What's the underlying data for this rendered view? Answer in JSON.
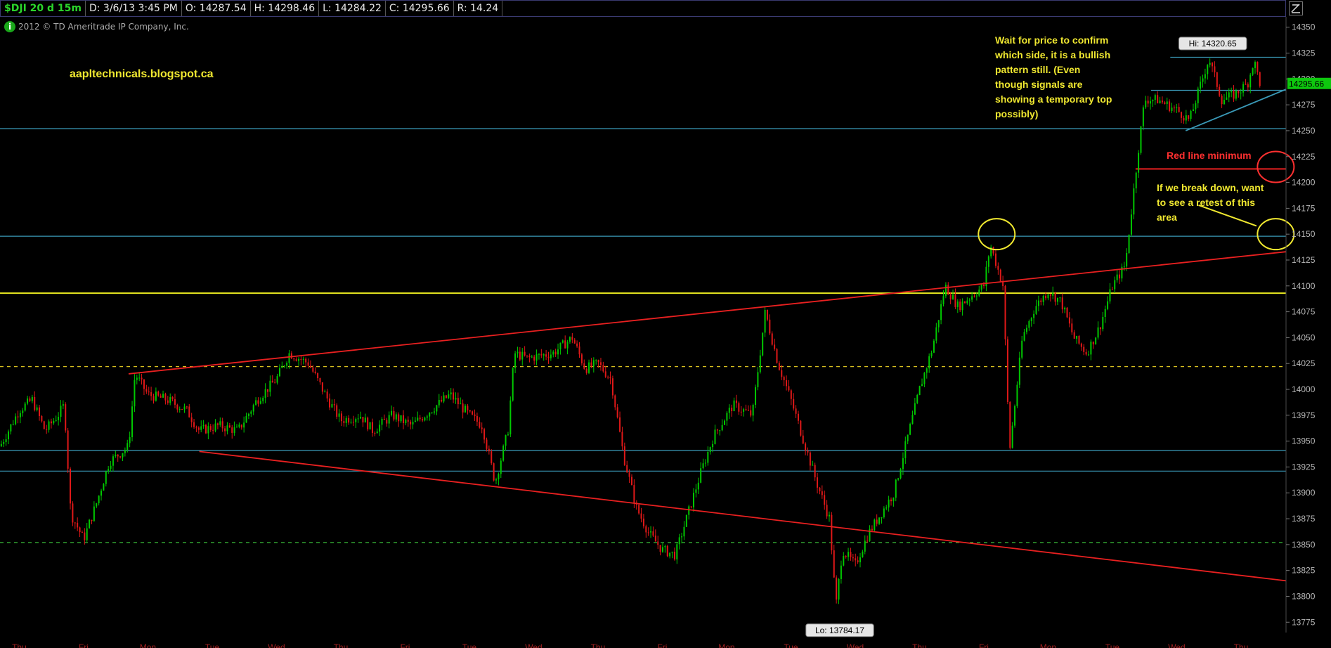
{
  "toolbar": {
    "symbol": "$DJI 20 d 15m",
    "date": "D: 3/6/13 3:45 PM",
    "open": "O: 14287.54",
    "high": "H: 14298.46",
    "low": "L: 14284.22",
    "close": "C: 14295.66",
    "range": "R: 14.24"
  },
  "copyright": "2012 © TD Ameritrade IP Company, Inc.",
  "icons": {
    "info": "info-circle-icon",
    "menu": "chart-settings-icon"
  },
  "colors": {
    "background": "#000000",
    "up_candle": "#00c800",
    "down_candle": "#e01818",
    "support_line": "#3a9ab8",
    "yellow_line": "#e8e820",
    "trend_line": "#e82020",
    "dashed_yellow": "#d8c020",
    "dashed_green": "#40d040",
    "annotation_yellow": "#f0e830",
    "annotation_red": "#ff3030",
    "current_price_bg": "#0ec80e",
    "axis_text": "#b8b8b8",
    "day_label": "#a02020"
  },
  "chart_data": {
    "type": "candlestick",
    "title": "$DJI 20 d 15m",
    "ylabel": "",
    "ylim": [
      13765,
      14360
    ],
    "y_ticks": [
      13775,
      13800,
      13825,
      13850,
      13875,
      13900,
      13925,
      13950,
      13975,
      14000,
      14025,
      14050,
      14075,
      14100,
      14125,
      14150,
      14175,
      14200,
      14225,
      14250,
      14275,
      14300,
      14325,
      14350
    ],
    "x_day_labels": [
      "Thu",
      "Fri",
      "Mon",
      "Tue",
      "Wed",
      "Thu",
      "Fri",
      "Tue",
      "Wed",
      "Thu",
      "Fri",
      "Mon",
      "Tue",
      "Wed",
      "Thu",
      "Fri",
      "Mon",
      "Tue",
      "Wed",
      "Thu"
    ],
    "x_extent": [
      0,
      100
    ],
    "price_path": [
      [
        0,
        13945
      ],
      [
        1.5,
        13980
      ],
      [
        2.5,
        13990
      ],
      [
        3.5,
        13960
      ],
      [
        4.5,
        13975
      ],
      [
        5,
        13985
      ],
      [
        5.5,
        13880
      ],
      [
        6.5,
        13855
      ],
      [
        7.5,
        13890
      ],
      [
        8.5,
        13930
      ],
      [
        10,
        13945
      ],
      [
        10.5,
        14015
      ],
      [
        11.5,
        13995
      ],
      [
        13,
        13990
      ],
      [
        14.5,
        13980
      ],
      [
        15.5,
        13960
      ],
      [
        17,
        13965
      ],
      [
        18.5,
        13960
      ],
      [
        20,
        13990
      ],
      [
        21.5,
        14010
      ],
      [
        22.5,
        14035
      ],
      [
        24,
        14025
      ],
      [
        25.5,
        13990
      ],
      [
        26.5,
        13970
      ],
      [
        28,
        13975
      ],
      [
        29,
        13960
      ],
      [
        30.5,
        13975
      ],
      [
        32,
        13965
      ],
      [
        33.5,
        13980
      ],
      [
        35,
        13995
      ],
      [
        36.5,
        13975
      ],
      [
        37.5,
        13965
      ],
      [
        38.5,
        13910
      ],
      [
        39.5,
        13960
      ],
      [
        40,
        14035
      ],
      [
        41,
        14030
      ],
      [
        43,
        14035
      ],
      [
        44.5,
        14050
      ],
      [
        45.5,
        14020
      ],
      [
        46.5,
        14025
      ],
      [
        47.5,
        14010
      ],
      [
        48.5,
        13935
      ],
      [
        49.5,
        13885
      ],
      [
        50.5,
        13860
      ],
      [
        51.5,
        13845
      ],
      [
        52.5,
        13840
      ],
      [
        53.5,
        13880
      ],
      [
        54.5,
        13920
      ],
      [
        55.5,
        13955
      ],
      [
        57,
        13985
      ],
      [
        58.5,
        13975
      ],
      [
        59.5,
        14075
      ],
      [
        60.5,
        14025
      ],
      [
        61.5,
        13990
      ],
      [
        62.5,
        13950
      ],
      [
        63.5,
        13910
      ],
      [
        64.5,
        13875
      ],
      [
        65,
        13790
      ],
      [
        65.5,
        13845
      ],
      [
        66.5,
        13830
      ],
      [
        67.5,
        13860
      ],
      [
        68.5,
        13880
      ],
      [
        69.5,
        13900
      ],
      [
        70.5,
        13950
      ],
      [
        71.5,
        14000
      ],
      [
        72.5,
        14040
      ],
      [
        73.5,
        14100
      ],
      [
        74.5,
        14080
      ],
      [
        75.5,
        14090
      ],
      [
        76.5,
        14100
      ],
      [
        77,
        14140
      ],
      [
        78,
        14100
      ],
      [
        78.5,
        13940
      ],
      [
        79.5,
        14050
      ],
      [
        80.5,
        14080
      ],
      [
        81.5,
        14095
      ],
      [
        82.5,
        14085
      ],
      [
        83.5,
        14050
      ],
      [
        84.5,
        14035
      ],
      [
        85.5,
        14060
      ],
      [
        86.5,
        14100
      ],
      [
        87.5,
        14120
      ],
      [
        88.5,
        14230
      ],
      [
        89,
        14280
      ],
      [
        90,
        14280
      ],
      [
        91.5,
        14270
      ],
      [
        92.5,
        14260
      ],
      [
        93.5,
        14300
      ],
      [
        94,
        14320
      ],
      [
        95,
        14280
      ],
      [
        96,
        14285
      ],
      [
        97,
        14295
      ],
      [
        97.5,
        14318
      ],
      [
        98,
        14295
      ]
    ],
    "high_label": "Hi: 14320.65",
    "low_label": "Lo: 13784.17",
    "current_price": "14295.66",
    "horizontal_lines": [
      {
        "color": "support_line",
        "y": 14252,
        "style": "solid"
      },
      {
        "color": "support_line",
        "y": 14148,
        "style": "solid"
      },
      {
        "color": "yellow_line",
        "y": 14093,
        "style": "solid"
      },
      {
        "color": "dashed_yellow",
        "y": 14022,
        "style": "dashed"
      },
      {
        "color": "support_line",
        "y": 13941,
        "style": "solid"
      },
      {
        "color": "support_line",
        "y": 13921,
        "style": "solid"
      },
      {
        "color": "dashed_green",
        "y": 13852,
        "style": "dashed"
      },
      {
        "color": "trend_line",
        "y": 14213,
        "x_start": 88.3,
        "style": "solid"
      },
      {
        "color": "support_line",
        "y": 14321,
        "x_start": 91,
        "style": "solid"
      },
      {
        "color": "support_line",
        "y": 14289,
        "x_start": 89.5,
        "style": "solid"
      }
    ],
    "trend_lines": [
      {
        "color": "trend_line",
        "points": [
          [
            10,
            14015
          ],
          [
            100,
            14133
          ]
        ]
      },
      {
        "color": "trend_line",
        "points": [
          [
            15.5,
            13940
          ],
          [
            100,
            13815
          ]
        ]
      },
      {
        "color": "support_line",
        "points": [
          [
            92.2,
            14250
          ],
          [
            100,
            14290
          ]
        ]
      }
    ],
    "circles": [
      {
        "color": "annotation_yellow",
        "x": 77.5,
        "y": 14150
      },
      {
        "color": "annotation_red",
        "x": 99.2,
        "y": 14215
      },
      {
        "color": "annotation_yellow",
        "x": 99.2,
        "y": 14150
      }
    ],
    "annotations": {
      "blog": "aapltechnicals.blogspot.ca",
      "note_confirm": [
        "Wait for price to confirm",
        "which side, it is a bullish",
        "pattern still. (Even",
        "though signals are",
        "showing a temporary top",
        "possibly)"
      ],
      "note_red_line": "Red line minimum",
      "note_break": [
        "If we break down, want",
        "to see a retest of this",
        "area"
      ]
    }
  }
}
